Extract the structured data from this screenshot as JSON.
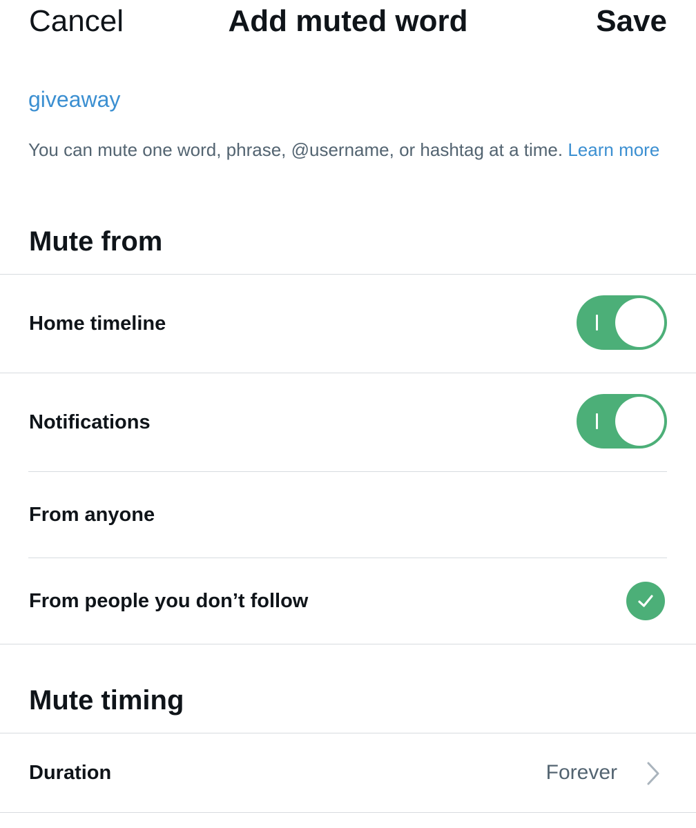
{
  "nav": {
    "cancel_label": "Cancel",
    "title": "Add muted word",
    "save_label": "Save"
  },
  "muted_word": {
    "value": "giveaway"
  },
  "hint": {
    "text": "You can mute one word, phrase, @username, or hashtag at a time.",
    "link": "Learn more"
  },
  "mute_from": {
    "title": "Mute from",
    "home_timeline": {
      "label": "Home timeline",
      "enabled": true
    },
    "notifications": {
      "label": "Notifications",
      "enabled": true
    },
    "options": [
      {
        "label": "From anyone",
        "selected": false
      },
      {
        "label": "From people you don’t follow",
        "selected": true
      }
    ]
  },
  "mute_timing": {
    "title": "Mute timing",
    "duration_label": "Duration",
    "duration_value": "Forever"
  },
  "colors": {
    "accent_blue": "#3b8fd1",
    "toggle_green": "#4caf78",
    "secondary_text": "#536471",
    "divider": "#d7dbdf"
  },
  "icons": {
    "check": "check-icon",
    "chevron": "chevron-right-icon"
  }
}
